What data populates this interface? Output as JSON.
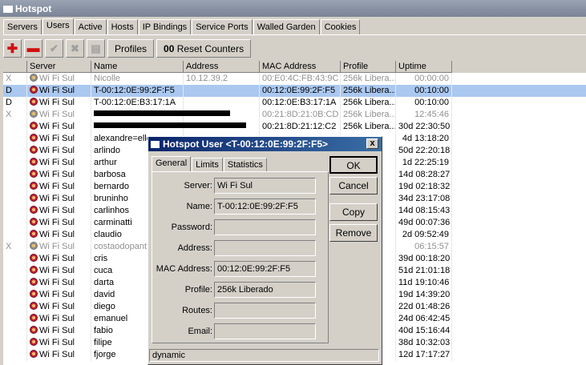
{
  "window": {
    "title": "Hotspot"
  },
  "tabs": [
    "Servers",
    "Users",
    "Active",
    "Hosts",
    "IP Bindings",
    "Service Ports",
    "Walled Garden",
    "Cookies"
  ],
  "toolbar": {
    "profiles_label": "Profiles",
    "reset_label": "Reset Counters",
    "reset_prefix": "00"
  },
  "columns": [
    "Server",
    "Name",
    "Address",
    "MAC Address",
    "Profile",
    "Uptime"
  ],
  "rows": [
    {
      "flag": "X",
      "server": "Wi Fi Sul",
      "name": "Nicolle",
      "address": "10.12.39.2",
      "mac": "00:E0:4C:FB:43:9C",
      "profile": "256k Libera...",
      "uptime": "00:00:00",
      "state": "disabled"
    },
    {
      "flag": "D",
      "server": "Wi Fi Sul",
      "name": "T-00:12:0E:99:2F:F5",
      "address": "",
      "mac": "00:12:0E:99:2F:F5",
      "profile": "256k Libera...",
      "uptime": "00:10:00",
      "state": "selected"
    },
    {
      "flag": "D",
      "server": "Wi Fi Sul",
      "name": "T-00:12:0E:B3:17:1A",
      "address": "",
      "mac": "00:12:0E:B3:17:1A",
      "profile": "256k Libera...",
      "uptime": "00:10:00",
      "state": "normal"
    },
    {
      "flag": "X",
      "server": "Wi Fi Sul",
      "name": "",
      "address": "",
      "mac": "00:21:8D:21:0B:CD",
      "profile": "256k Libera...",
      "uptime": "12:45:46",
      "state": "disabled"
    },
    {
      "flag": "",
      "server": "Wi Fi Sul",
      "name": "",
      "address": "",
      "mac": "00:21:8D:21:12:C2",
      "profile": "256k Libera...",
      "uptime": "30d 22:30:50",
      "state": "normal"
    },
    {
      "flag": "",
      "server": "Wi Fi Sul",
      "name": "alexandre=elle",
      "address": "",
      "mac": "",
      "profile": "",
      "uptime": "4d 13:18:20",
      "state": "normal"
    },
    {
      "flag": "",
      "server": "Wi Fi Sul",
      "name": "arlindo",
      "address": "",
      "mac": "",
      "profile": "",
      "uptime": "50d 22:20:18",
      "state": "normal"
    },
    {
      "flag": "",
      "server": "Wi Fi Sul",
      "name": "arthur",
      "address": "",
      "mac": "",
      "profile": "",
      "uptime": "1d 22:25:19",
      "state": "normal"
    },
    {
      "flag": "",
      "server": "Wi Fi Sul",
      "name": "barbosa",
      "address": "",
      "mac": "",
      "profile": "",
      "uptime": "14d 08:28:27",
      "state": "normal"
    },
    {
      "flag": "",
      "server": "Wi Fi Sul",
      "name": "bernardo",
      "address": "",
      "mac": "",
      "profile": "",
      "uptime": "19d 02:18:32",
      "state": "normal"
    },
    {
      "flag": "",
      "server": "Wi Fi Sul",
      "name": "bruninho",
      "address": "",
      "mac": "",
      "profile": "",
      "uptime": "34d 23:17:08",
      "state": "normal"
    },
    {
      "flag": "",
      "server": "Wi Fi Sul",
      "name": "carlinhos",
      "address": "",
      "mac": "",
      "profile": "",
      "uptime": "14d 08:15:43",
      "state": "normal"
    },
    {
      "flag": "",
      "server": "Wi Fi Sul",
      "name": "carminatti",
      "address": "",
      "mac": "",
      "profile": "",
      "uptime": "49d 00:07:36",
      "state": "normal"
    },
    {
      "flag": "",
      "server": "Wi Fi Sul",
      "name": "claudio",
      "address": "",
      "mac": "",
      "profile": "",
      "uptime": "2d 09:52:49",
      "state": "normal"
    },
    {
      "flag": "X",
      "server": "Wi Fi Sul",
      "name": "costaodopant",
      "address": "",
      "mac": "",
      "profile": "",
      "uptime": "06:15:57",
      "state": "disabled"
    },
    {
      "flag": "",
      "server": "Wi Fi Sul",
      "name": "cris",
      "address": "",
      "mac": "",
      "profile": "",
      "uptime": "39d 00:18:20",
      "state": "normal"
    },
    {
      "flag": "",
      "server": "Wi Fi Sul",
      "name": "cuca",
      "address": "",
      "mac": "",
      "profile": "",
      "uptime": "51d 21:01:18",
      "state": "normal"
    },
    {
      "flag": "",
      "server": "Wi Fi Sul",
      "name": "darta",
      "address": "",
      "mac": "",
      "profile": "",
      "uptime": "11d 19:10:46",
      "state": "normal"
    },
    {
      "flag": "",
      "server": "Wi Fi Sul",
      "name": "david",
      "address": "",
      "mac": "",
      "profile": "",
      "uptime": "19d 14:39:20",
      "state": "normal"
    },
    {
      "flag": "",
      "server": "Wi Fi Sul",
      "name": "diego",
      "address": "",
      "mac": "",
      "profile": "",
      "uptime": "22d 01:48:26",
      "state": "normal"
    },
    {
      "flag": "",
      "server": "Wi Fi Sul",
      "name": "emanuel",
      "address": "",
      "mac": "",
      "profile": "",
      "uptime": "24d 06:42:45",
      "state": "normal"
    },
    {
      "flag": "",
      "server": "Wi Fi Sul",
      "name": "fabio",
      "address": "",
      "mac": "",
      "profile": "",
      "uptime": "40d 15:16:44",
      "state": "normal"
    },
    {
      "flag": "",
      "server": "Wi Fi Sul",
      "name": "filipe",
      "address": "",
      "mac": "",
      "profile": "",
      "uptime": "38d 10:32:03",
      "state": "normal"
    },
    {
      "flag": "",
      "server": "Wi Fi Sul",
      "name": "fjorge",
      "address": "",
      "mac": "",
      "profile": "",
      "uptime": "12d 17:17:27",
      "state": "normal"
    }
  ],
  "dialog": {
    "title": "Hotspot User <T-00:12:0E:99:2F:F5>",
    "close": "x",
    "tabs": [
      "General",
      "Limits",
      "Statistics"
    ],
    "fields": [
      {
        "label": "Server:",
        "value": "Wi Fi Sul"
      },
      {
        "label": "Name:",
        "value": "T-00:12:0E:99:2F:F5"
      },
      {
        "label": "Password:",
        "value": ""
      },
      {
        "label": "Address:",
        "value": ""
      },
      {
        "label": "MAC Address:",
        "value": "00:12:0E:99:2F:F5"
      },
      {
        "label": "Profile:",
        "value": "256k Liberado"
      },
      {
        "label": "Routes:",
        "value": ""
      },
      {
        "label": "Email:",
        "value": ""
      }
    ],
    "buttons": {
      "ok": "OK",
      "cancel": "Cancel",
      "copy": "Copy",
      "remove": "Remove"
    },
    "status": "dynamic"
  }
}
